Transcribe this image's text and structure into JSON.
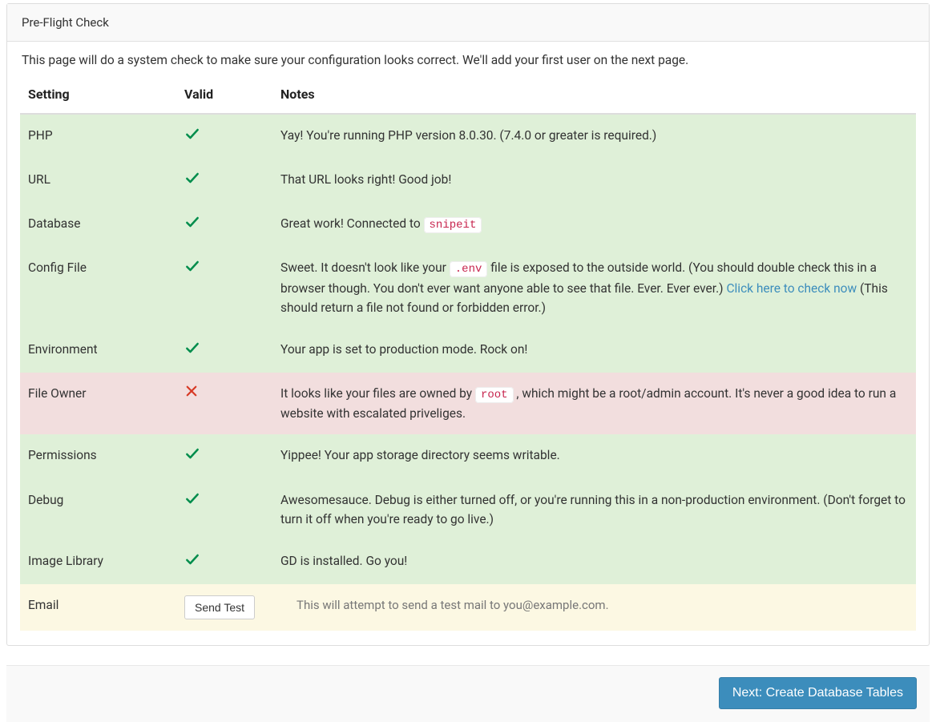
{
  "header": {
    "title": "Pre-Flight Check"
  },
  "intro": "This page will do a system check to make sure your configuration looks correct. We'll add your first user on the next page.",
  "table": {
    "columns": {
      "setting": "Setting",
      "valid": "Valid",
      "notes": "Notes"
    }
  },
  "rows": {
    "php": {
      "label": "PHP",
      "status": "success",
      "note": "Yay! You're running PHP version 8.0.30. (7.4.0 or greater is required.)"
    },
    "url": {
      "label": "URL",
      "status": "success",
      "note": "That URL looks right! Good job!"
    },
    "database": {
      "label": "Database",
      "status": "success",
      "note_pre": "Great work! Connected to ",
      "code": "snipeit"
    },
    "config": {
      "label": "Config File",
      "status": "success",
      "note_a": "Sweet. It doesn't look like your ",
      "code": ".env",
      "note_b": " file is exposed to the outside world. (You should double check this in a browser though. You don't ever want anyone able to see that file. Ever. Ever ever.) ",
      "link_text": "Click here to check now",
      "note_c": " (This should return a file not found or forbidden error.)"
    },
    "environment": {
      "label": "Environment",
      "status": "success",
      "note": "Your app is set to production mode. Rock on!"
    },
    "fileowner": {
      "label": "File Owner",
      "status": "danger",
      "note_a": "It looks like your files are owned by ",
      "code": "root",
      "note_b": " , which might be a root/admin account. It's never a good idea to run a website with escalated priveliges."
    },
    "permissions": {
      "label": "Permissions",
      "status": "success",
      "note": "Yippee! Your app storage directory seems writable."
    },
    "debug": {
      "label": "Debug",
      "status": "success",
      "note": "Awesomesauce. Debug is either turned off, or you're running this in a non-production environment. (Don't forget to turn it off when you're ready to go live.)"
    },
    "imagelib": {
      "label": "Image Library",
      "status": "success",
      "note": "GD is installed. Go you!"
    },
    "email": {
      "label": "Email",
      "status": "warning",
      "button": "Send Test",
      "note": "This will attempt to send a test mail to you@example.com."
    }
  },
  "footer": {
    "next_button": "Next: Create Database Tables"
  }
}
